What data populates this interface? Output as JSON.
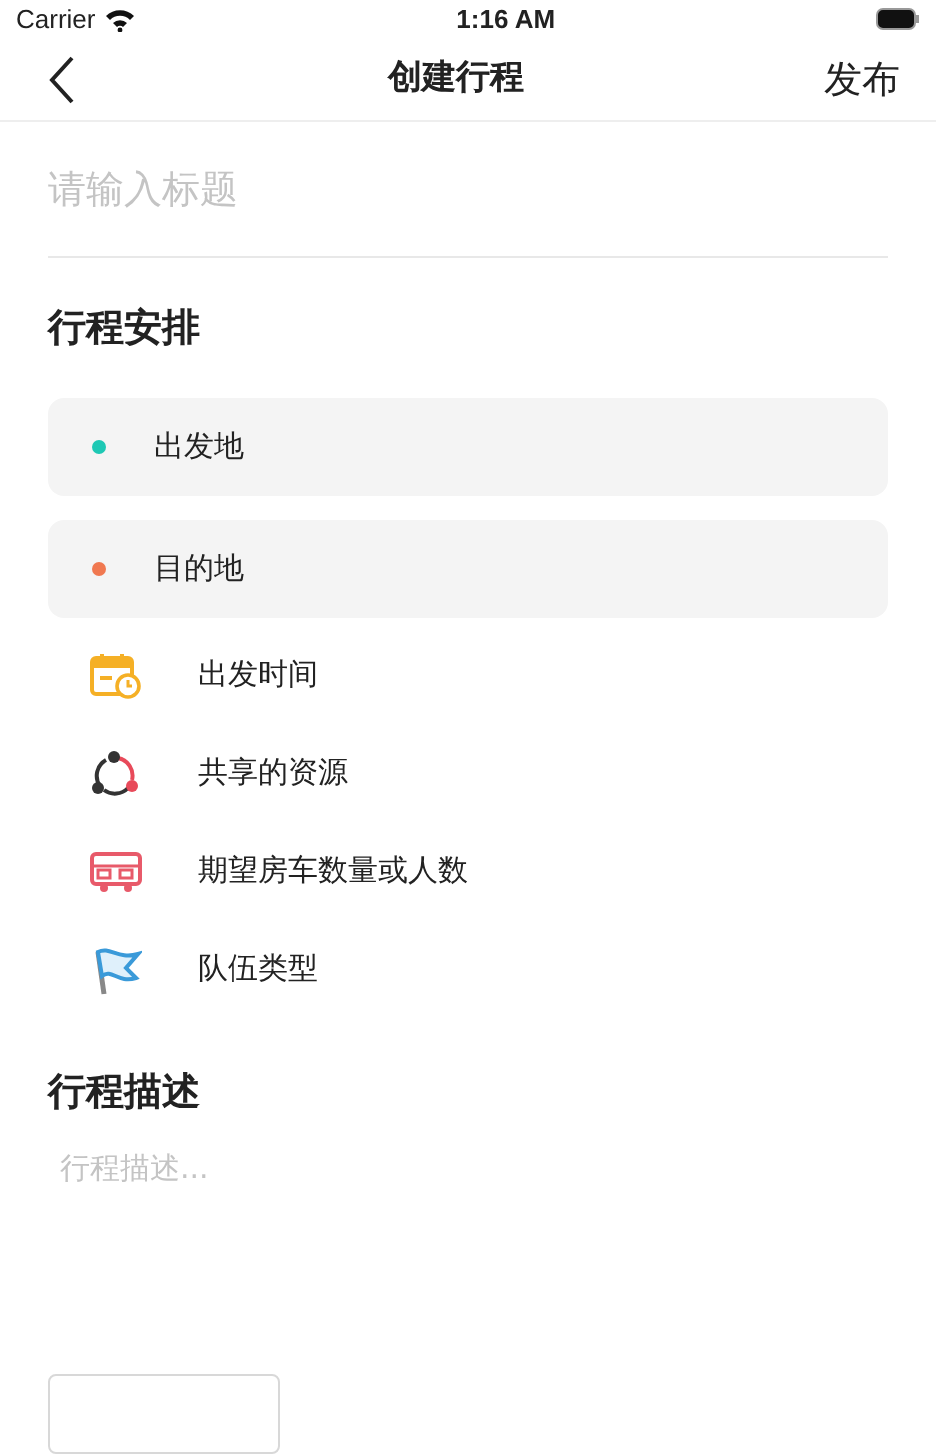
{
  "status_bar": {
    "carrier": "Carrier",
    "time": "1:16 AM"
  },
  "nav": {
    "title": "创建行程",
    "action": "发布"
  },
  "title_field": {
    "placeholder": "请输入标题"
  },
  "schedule": {
    "heading": "行程安排",
    "locations": [
      {
        "label": "出发地",
        "color": "#1ec8b4"
      },
      {
        "label": "目的地",
        "color": "#f07850"
      }
    ],
    "options": [
      {
        "kind": "calendar",
        "label": "出发时间"
      },
      {
        "kind": "share",
        "label": "共享的资源"
      },
      {
        "kind": "bus",
        "label": "期望房车数量或人数"
      },
      {
        "kind": "flag",
        "label": "队伍类型"
      }
    ]
  },
  "description": {
    "heading": "行程描述",
    "placeholder": "行程描述..."
  }
}
